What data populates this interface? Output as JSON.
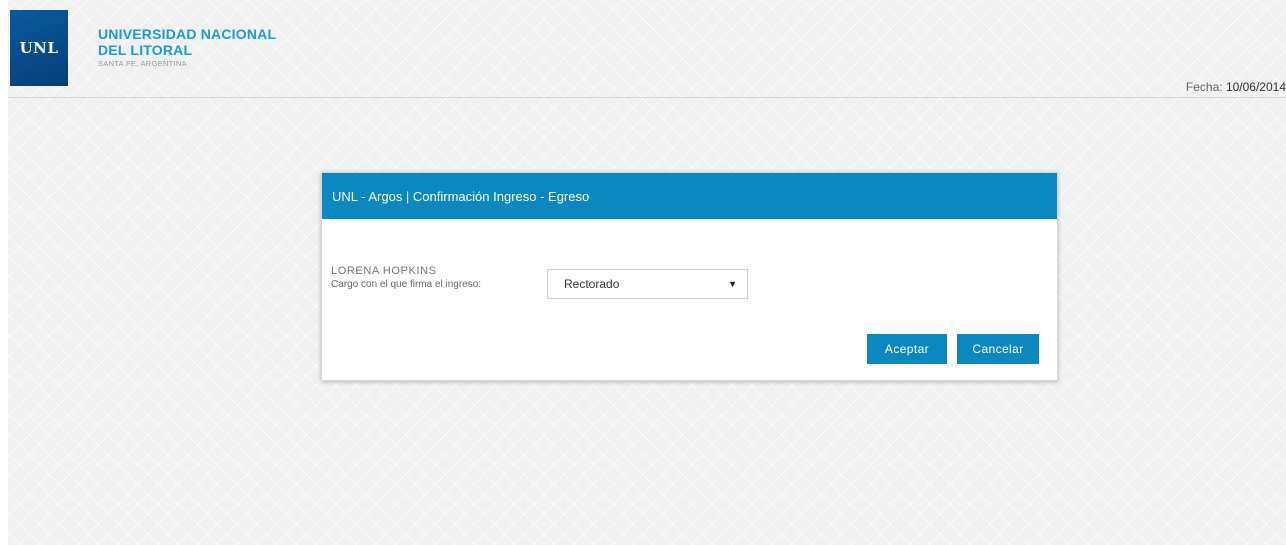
{
  "header": {
    "logo_text": "UNL",
    "brand_line1": "UNIVERSIDAD NACIONAL",
    "brand_line2": "DEL LITORAL",
    "brand_sub": "SANTA FE, ARGENTINA",
    "date_label": "Fecha: ",
    "date_value": "10/06/2014"
  },
  "modal": {
    "title": "UNL - Argos | Confirmación Ingreso - Egreso",
    "person_name": "LORENA  HOPKINS",
    "field_label": "Cargo con el que firma el ingreso:",
    "select": {
      "selected": "Rectorado",
      "arrow_icon": "triangle-down"
    },
    "accept_label": "Aceptar",
    "cancel_label": "Cancelar"
  },
  "colors": {
    "accent": "#0b88bf",
    "brand_blue": "#1a9bd7",
    "logo_blue": "#0a5aa0"
  }
}
